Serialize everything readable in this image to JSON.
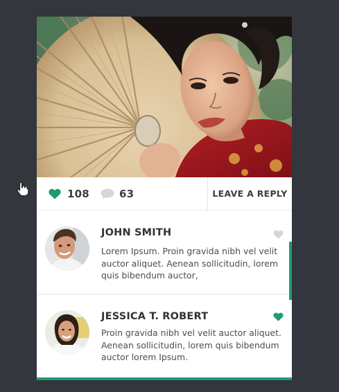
{
  "colors": {
    "background": "#33363c",
    "card": "#ffffff",
    "accent": "#1f9a73",
    "muted_icon": "#d4d6d8",
    "text_dark": "#2f3236",
    "text_body": "#4a4d52"
  },
  "post": {
    "photo_icon": "portrait-photo"
  },
  "stats": {
    "likes_count": "108",
    "likes_icon": "heart-icon",
    "comments_count": "63",
    "comments_icon": "speech-bubble-icon",
    "reply_label": "LEAVE A REPLY"
  },
  "comments": [
    {
      "name": "JOHN SMITH",
      "text": " Lorem Ipsum. Proin gravida nibh vel velit auctor aliquet. Aenean sollicitudin, lorem quis bibendum auctor,",
      "liked": false
    },
    {
      "name": "JESSICA T. ROBERT",
      "text": "Proin gravida nibh vel velit auctor aliquet. Aenean sollicitudin, lorem quis bibendum auctor lorem Ipsum.",
      "liked": true
    }
  ]
}
